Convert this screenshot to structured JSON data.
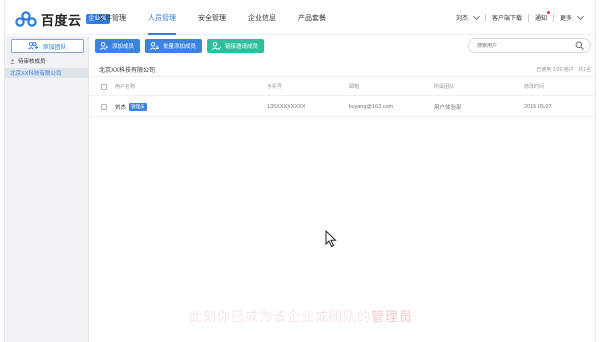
{
  "logo": {
    "text": "百度云",
    "badge": "企业版"
  },
  "nav": {
    "tabs": [
      "文件管理",
      "人员管理",
      "安全管理",
      "企业信息",
      "产品套餐"
    ],
    "active_tab": "人员管理",
    "user": "刘杰",
    "client_download": "客户端下载",
    "notice": "通知",
    "more": "更多"
  },
  "sidebar": {
    "add_team": "添加团队",
    "pending": "待审核成员",
    "company": "北京XX科技有限公司"
  },
  "toolbar": {
    "add_member": "添加成员",
    "batch_add": "批量添加成员",
    "invite_link": "链接邀请成员"
  },
  "search": {
    "placeholder": "搜索用户"
  },
  "company_header": {
    "title": "北京XX科技有限公司",
    "stat": "已使用 1/20 用户 · 共1名"
  },
  "table": {
    "headers": [
      "用户名称",
      "手机号",
      "邮箱",
      "所属团队",
      "修改时间"
    ],
    "rows": [
      {
        "name": "刘杰",
        "badge": "管理员",
        "phone": "135XXXXXXXX",
        "email": "liuyang@163.com",
        "team": "用户体验部",
        "time": "2015.05.07"
      }
    ]
  },
  "subtitle": {
    "prefix": "此刻你已成为该企业或团队的",
    "highlight": "管理员"
  },
  "colors": {
    "accent": "#3c83e0",
    "green": "#2fbe9b",
    "sidebar_bg": "#f0f2f5"
  }
}
